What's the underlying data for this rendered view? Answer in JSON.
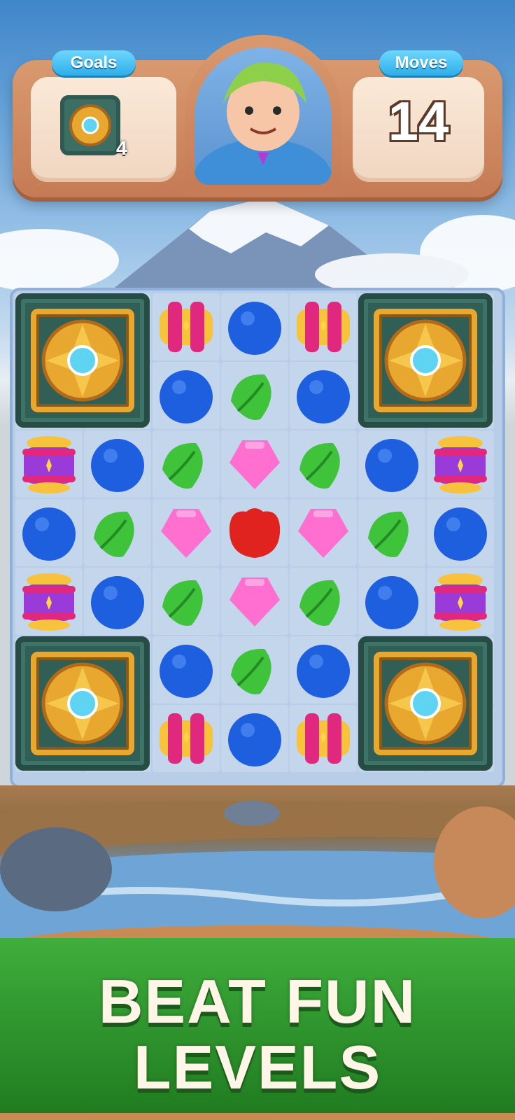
{
  "hud": {
    "goals_label": "Goals",
    "goal_item": "golden-gem-tile-icon",
    "goal_count": "4",
    "moves_label": "Moves",
    "moves_value": "14",
    "character": "green-haired-character-portrait"
  },
  "board": {
    "rows": 7,
    "cols": 7,
    "pieces": [
      [
        "tile",
        "barrel",
        "blue",
        "barrel",
        "tile"
      ],
      [
        "tile",
        "blue",
        "leaf",
        "blue",
        "tile"
      ],
      [
        "lantern",
        "blue",
        "leaf",
        "pink",
        "leaf",
        "blue",
        "lantern"
      ],
      [
        "blue",
        "leaf",
        "pink",
        "red",
        "pink",
        "leaf",
        "blue"
      ],
      [
        "lantern",
        "blue",
        "leaf",
        "pink",
        "leaf",
        "blue",
        "lantern"
      ],
      [
        "tile",
        "blue",
        "leaf",
        "blue",
        "tile"
      ],
      [
        "tile",
        "barrel",
        "blue",
        "barrel",
        "tile"
      ]
    ]
  },
  "colors": {
    "blue": "#1e5fe0",
    "leaf": "#3ec33a",
    "pink": "#ff6fd0",
    "red": "#e0231f",
    "barrel": "#e0297e",
    "gold": "#e8a830"
  },
  "banner": {
    "line1": "BEAT FUN",
    "line2": "LEVELS"
  }
}
